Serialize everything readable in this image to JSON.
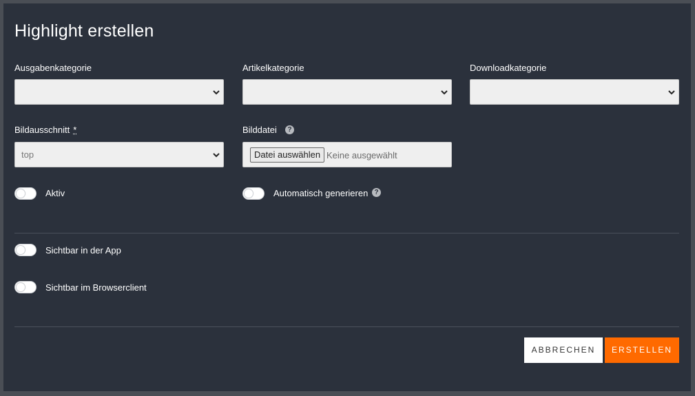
{
  "dialog": {
    "title": "Highlight erstellen"
  },
  "fields": {
    "ausgabenkategorie": {
      "label": "Ausgabenkategorie",
      "value": ""
    },
    "artikelkategorie": {
      "label": "Artikelkategorie",
      "value": ""
    },
    "downloadkategorie": {
      "label": "Downloadkategorie",
      "value": ""
    },
    "bildausschnitt": {
      "label": "Bildausschnitt",
      "required_mark": "*",
      "value": "top"
    },
    "bilddatei": {
      "label": "Bilddatei",
      "button_label": "Datei auswählen",
      "status": "Keine ausgewählt"
    }
  },
  "toggles": {
    "aktiv": {
      "label": "Aktiv",
      "checked": false
    },
    "auto_generate": {
      "label": "Automatisch generieren",
      "checked": false
    },
    "app": {
      "label": "Sichtbar in der App",
      "checked": false
    },
    "browser": {
      "label": "Sichtbar im Browserclient",
      "checked": false
    }
  },
  "actions": {
    "cancel_label": "ABBRECHEN",
    "create_label": "ERSTELLEN"
  },
  "icons": {
    "help": "question-circle-icon",
    "select_arrow": "chevron-down-icon"
  },
  "colors": {
    "background": "#2b313c",
    "accent": "#ff6a00"
  }
}
